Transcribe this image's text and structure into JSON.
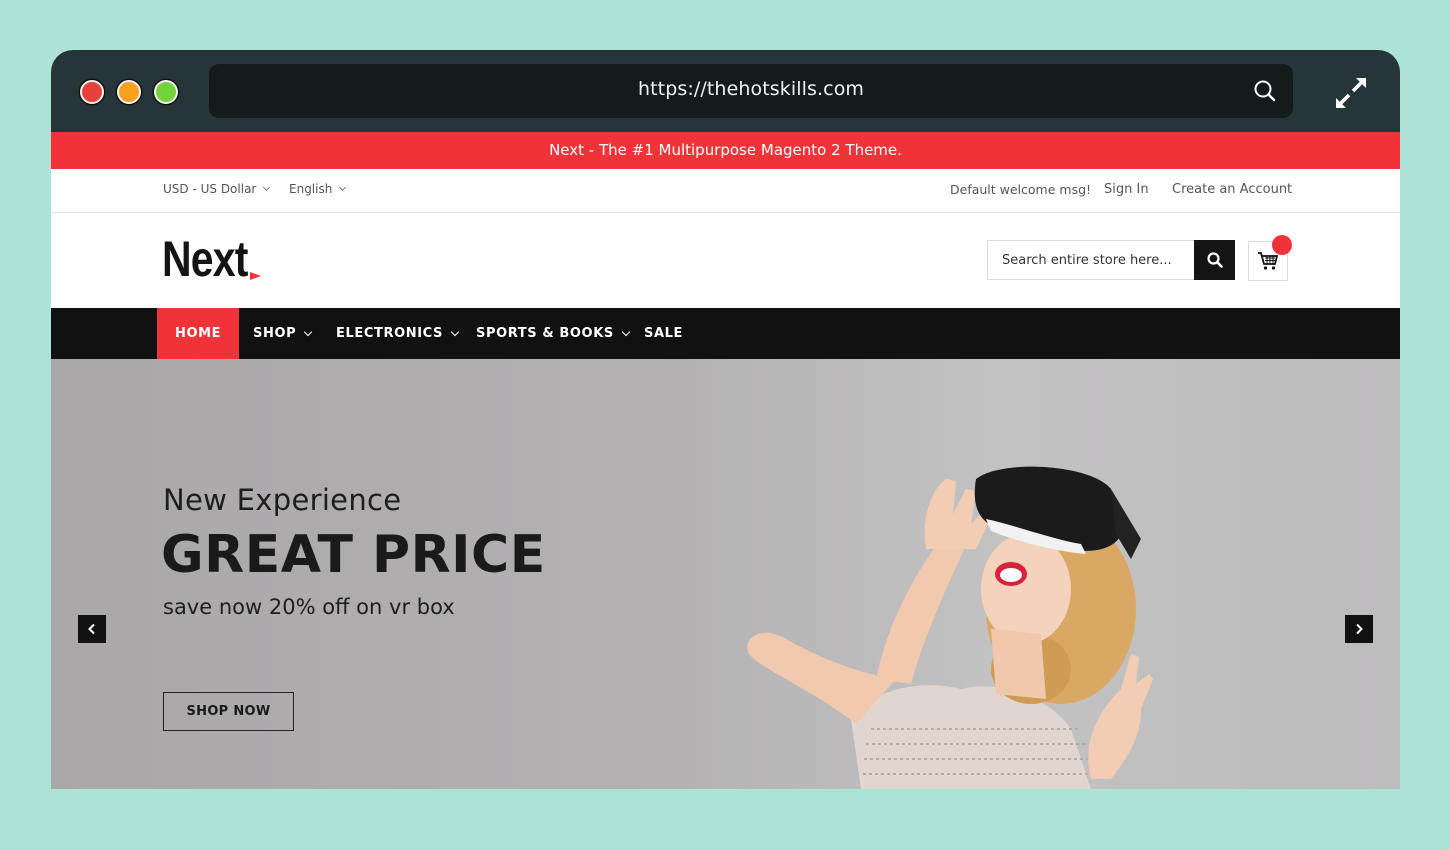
{
  "browser": {
    "url": "https://thehotskills.com",
    "window_controls": [
      "close",
      "minimize",
      "maximize"
    ],
    "icons": {
      "search": "search-icon",
      "fullscreen": "expand-icon"
    }
  },
  "promo_bar": {
    "text": "Next - The #1 Multipurpose Magento 2 Theme."
  },
  "utility_bar": {
    "currency": "USD - US Dollar",
    "language": "English",
    "welcome": "Default welcome msg!",
    "sign_in": "Sign In",
    "create_account": "Create an Account"
  },
  "header": {
    "logo": "Next",
    "search_placeholder": "Search entire store here...",
    "icons": {
      "search": "search-icon",
      "cart": "cart-icon"
    }
  },
  "nav": {
    "items": [
      {
        "label": "HOME",
        "active": true,
        "dropdown": false
      },
      {
        "label": "SHOP",
        "active": false,
        "dropdown": true
      },
      {
        "label": "ELECTRONICS",
        "active": false,
        "dropdown": true
      },
      {
        "label": "SPORTS & BOOKS",
        "active": false,
        "dropdown": true
      },
      {
        "label": "SALE",
        "active": false,
        "dropdown": false
      }
    ]
  },
  "hero": {
    "subtitle": "New Experience",
    "headline": "GREAT PRICE",
    "tagline": "save now 20% off on vr box",
    "cta": "SHOP NOW",
    "image_alt": "Woman wearing VR headset"
  },
  "colors": {
    "accent": "#ef3338",
    "page_background": "#ade3d6",
    "chrome": "#263638",
    "nav": "#111111"
  }
}
